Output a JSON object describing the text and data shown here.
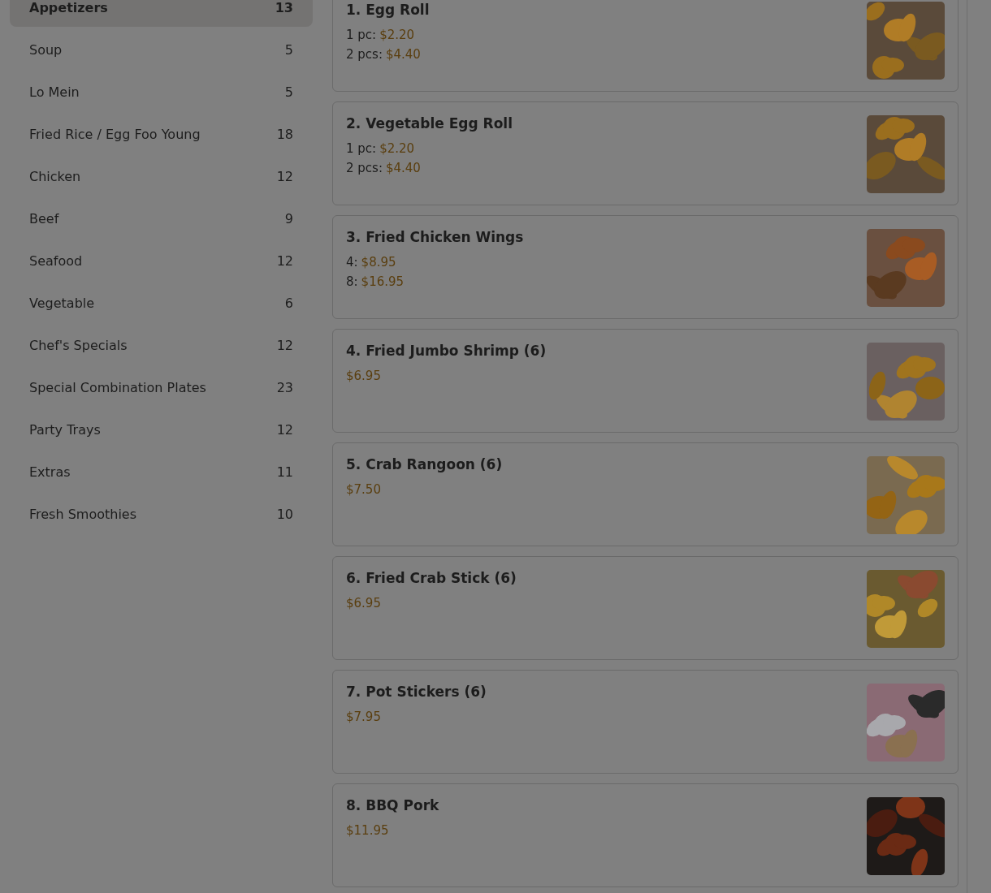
{
  "categories": [
    {
      "name": "Appetizers",
      "count": "13",
      "selected": true
    },
    {
      "name": "Soup",
      "count": "5",
      "selected": false
    },
    {
      "name": "Lo Mein",
      "count": "5",
      "selected": false
    },
    {
      "name": "Fried Rice / Egg Foo Young",
      "count": "18",
      "selected": false
    },
    {
      "name": "Chicken",
      "count": "12",
      "selected": false
    },
    {
      "name": "Beef",
      "count": "9",
      "selected": false
    },
    {
      "name": "Seafood",
      "count": "12",
      "selected": false
    },
    {
      "name": "Vegetable",
      "count": "6",
      "selected": false
    },
    {
      "name": "Chef's Specials",
      "count": "12",
      "selected": false
    },
    {
      "name": "Special Combination Plates",
      "count": "23",
      "selected": false
    },
    {
      "name": "Party Trays",
      "count": "12",
      "selected": false
    },
    {
      "name": "Extras",
      "count": "11",
      "selected": false
    },
    {
      "name": "Fresh Smoothies",
      "count": "10",
      "selected": false
    }
  ],
  "items": [
    {
      "title": "1. Egg Roll",
      "prices": [
        {
          "label": "1 pc:",
          "price": "$2.20"
        },
        {
          "label": "2 pcs:",
          "price": "$4.40"
        }
      ],
      "image": {
        "kind": "picture"
      }
    },
    {
      "title": "2. Vegetable Egg Roll",
      "prices": [
        {
          "label": "1 pc:",
          "price": "$2.20"
        },
        {
          "label": "2 pcs:",
          "price": "$4.40"
        }
      ],
      "image": {
        "kind": "picture"
      }
    },
    {
      "title": "3. Fried Chicken Wings",
      "prices": [
        {
          "label": "4:",
          "price": "$8.95"
        },
        {
          "label": "8:",
          "price": "$16.95"
        }
      ],
      "image": {
        "kind": "picture"
      }
    },
    {
      "title": "4. Fried Jumbo Shrimp (6)",
      "prices": [
        {
          "price": "$6.95"
        }
      ],
      "image": {
        "kind": "picture"
      }
    },
    {
      "title": "5. Crab Rangoon (6)",
      "prices": [
        {
          "price": "$7.50"
        }
      ],
      "image": {
        "kind": "picture"
      }
    },
    {
      "title": "6. Fried Crab Stick (6)",
      "prices": [
        {
          "price": "$6.95"
        }
      ],
      "image": {
        "kind": "picture"
      }
    },
    {
      "title": "7. Pot Stickers (6)",
      "prices": [
        {
          "price": "$7.95"
        }
      ],
      "image": {
        "kind": "picture"
      }
    },
    {
      "title": "8. BBQ Pork",
      "prices": [
        {
          "price": "$11.95"
        }
      ],
      "image": {
        "kind": "picture"
      }
    }
  ]
}
